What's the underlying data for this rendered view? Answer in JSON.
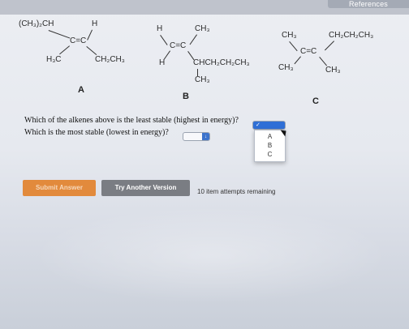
{
  "header": {
    "references_label": "References"
  },
  "molecule_a": {
    "label": "A",
    "top_left": "(CH₃)₂CH",
    "top_right": "H",
    "center": "C=C",
    "bottom_left": "H₃C",
    "bottom_right": "CH₂CH₃"
  },
  "molecule_b": {
    "label": "B",
    "top_left": "H",
    "top_right": "CH₃",
    "center": "C=C",
    "bottom_left": "H",
    "bottom_right": "CHCH₂CH₂CH₃",
    "branch": "CH₃"
  },
  "molecule_c": {
    "label": "C",
    "top_left": "CH₃",
    "top_right": "CH₂CH₂CH₃",
    "center": "C=C",
    "bottom_left": "CH₃",
    "bottom_right": "CH₃"
  },
  "questions": {
    "q1": "Which of the alkenes above is the least stable (highest in energy)?",
    "q2": "Which is the most stable (lowest in energy)?"
  },
  "dropdown": {
    "q1_selected": "",
    "q2_selected": "",
    "options": [
      "A",
      "B",
      "C"
    ],
    "arrow": "↓"
  },
  "buttons": {
    "submit": "Submit Answer",
    "try_another": "Try Another Version"
  },
  "attempts_text": "10 item attempts remaining",
  "colors": {
    "submit": "#e28a3c",
    "try_another": "#7a7d83",
    "select_active": "#2f6fd6"
  }
}
